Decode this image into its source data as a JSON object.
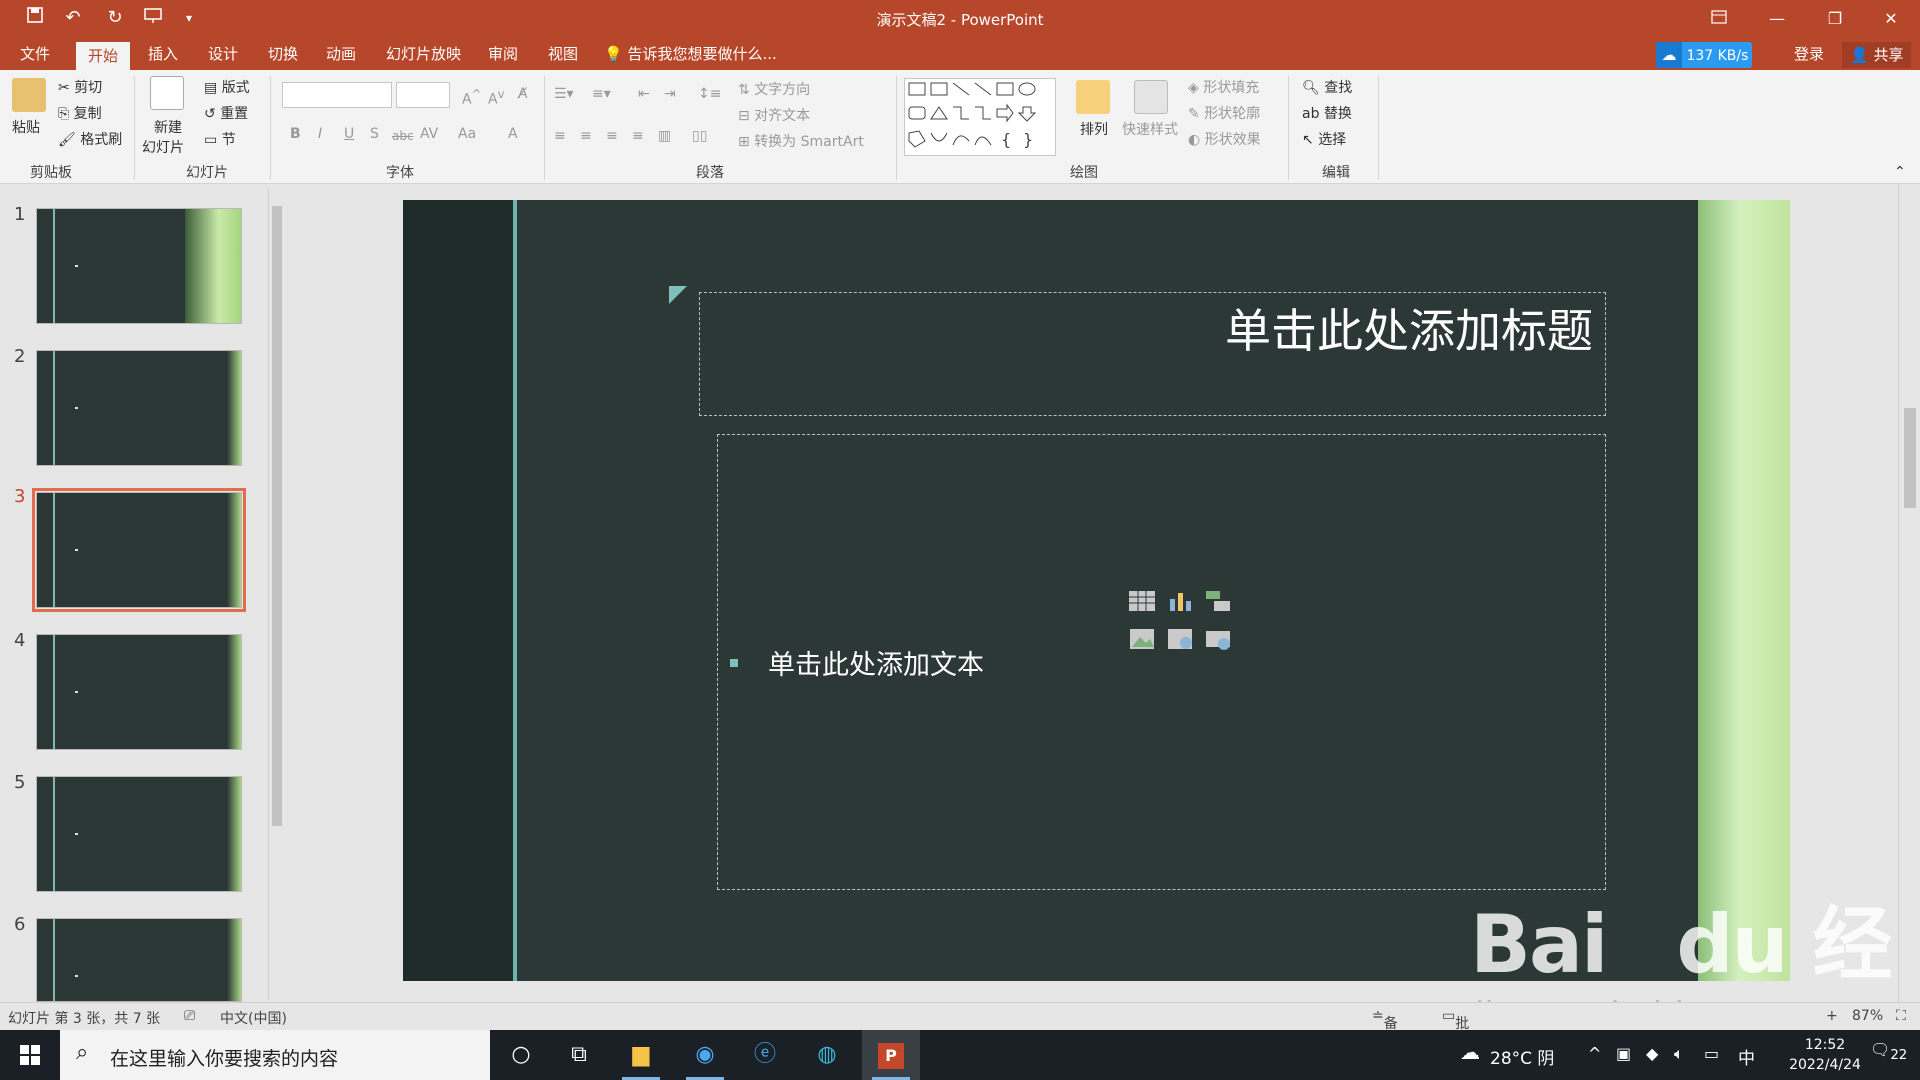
{
  "app": {
    "doc_title": "演示文稿2 - PowerPoint"
  },
  "quick_access": {
    "undo_label": "↶",
    "redo_label": "↻"
  },
  "menu": {
    "tabs": [
      "文件",
      "开始",
      "插入",
      "设计",
      "切换",
      "动画",
      "幻灯片放映",
      "审阅",
      "视图"
    ],
    "active_tab": "开始",
    "tell_me": "告诉我您想要做什么...",
    "net_speed": "137 KB/s",
    "login": "登录",
    "share": "共享"
  },
  "ribbon": {
    "clipboard": {
      "paste": "粘贴",
      "cut": "剪切",
      "copy": "复制",
      "format_painter": "格式刷",
      "label": "剪贴板"
    },
    "slides": {
      "new_slide_1": "新建",
      "new_slide_2": "幻灯片",
      "layout": "版式",
      "reset": "重置",
      "section": "节",
      "label": "幻灯片"
    },
    "font": {
      "label": "字体",
      "bold": "B",
      "italic": "I",
      "underline": "U",
      "shadow": "S",
      "strike": "abc",
      "spacing": "AV",
      "case": "Aa",
      "color": "A"
    },
    "paragraph": {
      "label": "段落",
      "text_direction": "文字方向",
      "align_text": "对齐文本",
      "smartart": "转换为 SmartArt"
    },
    "drawing": {
      "label": "绘图",
      "arrange": "排列",
      "quick_styles": "快速样式",
      "shape_fill": "形状填充",
      "shape_outline": "形状轮廓",
      "shape_effects": "形状效果"
    },
    "editing": {
      "label": "编辑",
      "find": "查找",
      "replace": "替换",
      "select": "选择"
    }
  },
  "thumbnails": [
    {
      "num": "1"
    },
    {
      "num": "2"
    },
    {
      "num": "3"
    },
    {
      "num": "4"
    },
    {
      "num": "5"
    },
    {
      "num": "6"
    }
  ],
  "selected_slide": "3",
  "slide": {
    "title_placeholder": "单击此处添加标题",
    "content_placeholder": "单击此处添加文本"
  },
  "status": {
    "slide_info": "幻灯片 第 3 张，共 7 张",
    "language": "中文(中国)",
    "notes": "备注",
    "comments": "批注",
    "zoom": "87%"
  },
  "taskbar": {
    "search_placeholder": "在这里输入你要搜索的内容",
    "weather": "28°C 阴",
    "ime": "中",
    "time": "12:52",
    "date": "2022/4/24",
    "notifications": "22"
  },
  "watermark": {
    "brand": "Bai du 经验",
    "url": "jingyan.baidu.com"
  },
  "colors": {
    "accent": "#b7472a",
    "slide_bg": "#2c3835",
    "slide_accent": "#6fb3ad"
  }
}
